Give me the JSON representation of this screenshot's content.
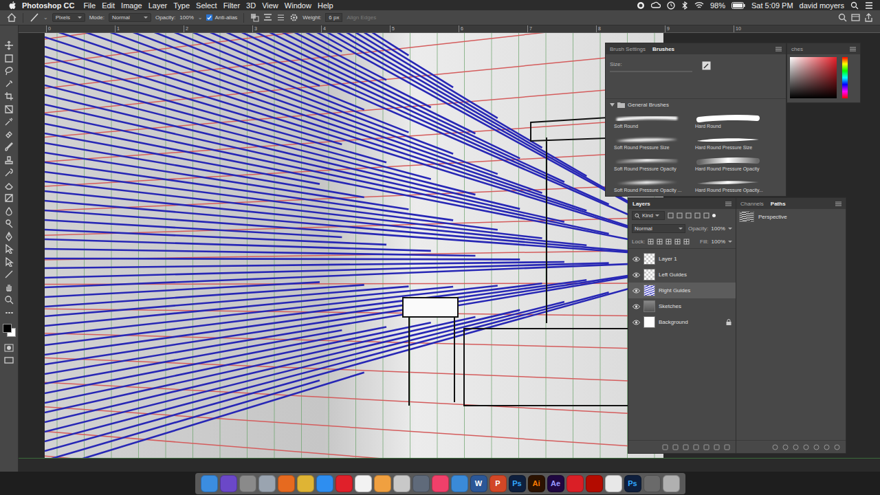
{
  "menubar": {
    "app": "Photoshop CC",
    "menus": [
      "File",
      "Edit",
      "Image",
      "Layer",
      "Type",
      "Select",
      "Filter",
      "3D",
      "View",
      "Window",
      "Help"
    ],
    "battery": "98%",
    "clock": "Sat 5:09 PM",
    "user": "david moyers"
  },
  "options": {
    "source": "Pixels",
    "mode_label": "Mode:",
    "mode": "Normal",
    "opacity_label": "Opacity:",
    "opacity": "100%",
    "anti_alias": {
      "label": "Anti-alias",
      "checked": true
    },
    "weight_label": "Weight:",
    "weight": "6 px",
    "align_edges": {
      "label": "Align Edges",
      "disabled": true
    }
  },
  "ruler": {
    "ticks": [
      "0",
      "1",
      "2",
      "3",
      "4",
      "5",
      "6",
      "7",
      "8",
      "9",
      "10"
    ]
  },
  "colors": {
    "foreground": "#000000",
    "background": "#ffffff"
  },
  "brushes_panel": {
    "tabs": [
      {
        "label": "Brush Settings",
        "selected": false
      },
      {
        "label": "Brushes",
        "selected": true
      }
    ],
    "size_label": "Size:",
    "group": {
      "label": "General Brushes",
      "expanded": true
    },
    "brushes": [
      {
        "name": "Soft Round",
        "hard": false,
        "pressure_size": false,
        "pressure_opacity": false
      },
      {
        "name": "Hard Round",
        "hard": true,
        "pressure_size": false,
        "pressure_opacity": false
      },
      {
        "name": "Soft Round Pressure Size",
        "hard": false,
        "pressure_size": true,
        "pressure_opacity": false
      },
      {
        "name": "Hard Round Pressure Size",
        "hard": true,
        "pressure_size": true,
        "pressure_opacity": false
      },
      {
        "name": "Soft Round Pressure Opacity",
        "hard": false,
        "pressure_size": false,
        "pressure_opacity": true
      },
      {
        "name": "Hard Round Pressure Opacity",
        "hard": true,
        "pressure_size": false,
        "pressure_opacity": true
      },
      {
        "name": "Soft Round Pressure Opacity ...",
        "hard": false,
        "pressure_size": true,
        "pressure_opacity": true
      },
      {
        "name": "Hard Round Pressure Opacity...",
        "hard": true,
        "pressure_size": true,
        "pressure_opacity": true
      }
    ]
  },
  "color_panel": {
    "tab": "ches",
    "hue": "#e8202a"
  },
  "layers_panel": {
    "tab": {
      "label": "Layers",
      "selected": true
    },
    "filter": "Kind",
    "blend_mode": "Normal",
    "opacity_label": "Opacity:",
    "opacity": "100%",
    "lock_label": "Lock:",
    "fill_label": "Fill:",
    "fill": "100%",
    "layers": [
      {
        "name": "Layer 1",
        "visible": true,
        "selected": false,
        "locked": false,
        "kind": "transparent"
      },
      {
        "name": "Left Guides",
        "visible": true,
        "selected": false,
        "locked": false,
        "kind": "transparent"
      },
      {
        "name": "Right Guides",
        "visible": true,
        "selected": true,
        "locked": false,
        "kind": "guides"
      },
      {
        "name": "Sketches",
        "visible": true,
        "selected": false,
        "locked": false,
        "kind": "sketch"
      },
      {
        "name": "Background",
        "visible": true,
        "selected": false,
        "locked": true,
        "kind": "fill"
      }
    ]
  },
  "paths_panel": {
    "tabs": [
      {
        "label": "Channels",
        "selected": false
      },
      {
        "label": "Paths",
        "selected": true
      }
    ],
    "paths": [
      {
        "name": "Perspective",
        "selected": false
      }
    ]
  },
  "dock": [
    {
      "color": "#3b8de0"
    },
    {
      "color": "#6b48c8"
    },
    {
      "color": "#8a8a8a"
    },
    {
      "color": "#9aa4b0"
    },
    {
      "color": "#e66a1f"
    },
    {
      "color": "#dfb434"
    },
    {
      "color": "#2e8ef0"
    },
    {
      "color": "#e0202a"
    },
    {
      "color": "#f2f2f2"
    },
    {
      "color": "#f0a040"
    },
    {
      "color": "#c8c8c8"
    },
    {
      "color": "#5f6a7a"
    },
    {
      "color": "#f0406a"
    },
    {
      "color": "#3a8ad8"
    },
    {
      "color": "#2b5797",
      "label": "W",
      "text_color": "#ffffff"
    },
    {
      "color": "#d24726",
      "label": "P",
      "text_color": "#ffffff"
    },
    {
      "color": "#0e1f3d",
      "label": "Ps",
      "text_color": "#31a8ff"
    },
    {
      "color": "#2b1200",
      "label": "Ai",
      "text_color": "#ff7c00"
    },
    {
      "color": "#1f0740",
      "label": "Ae",
      "text_color": "#9999ff"
    },
    {
      "color": "#da1f26"
    },
    {
      "color": "#b30b00"
    },
    {
      "color": "#e8e8e8"
    },
    {
      "color": "#0e1f3d",
      "label": "Ps",
      "text_color": "#31a8ff"
    },
    {
      "color": "#6a6a6a"
    },
    {
      "color": "#b0b0b0"
    }
  ]
}
